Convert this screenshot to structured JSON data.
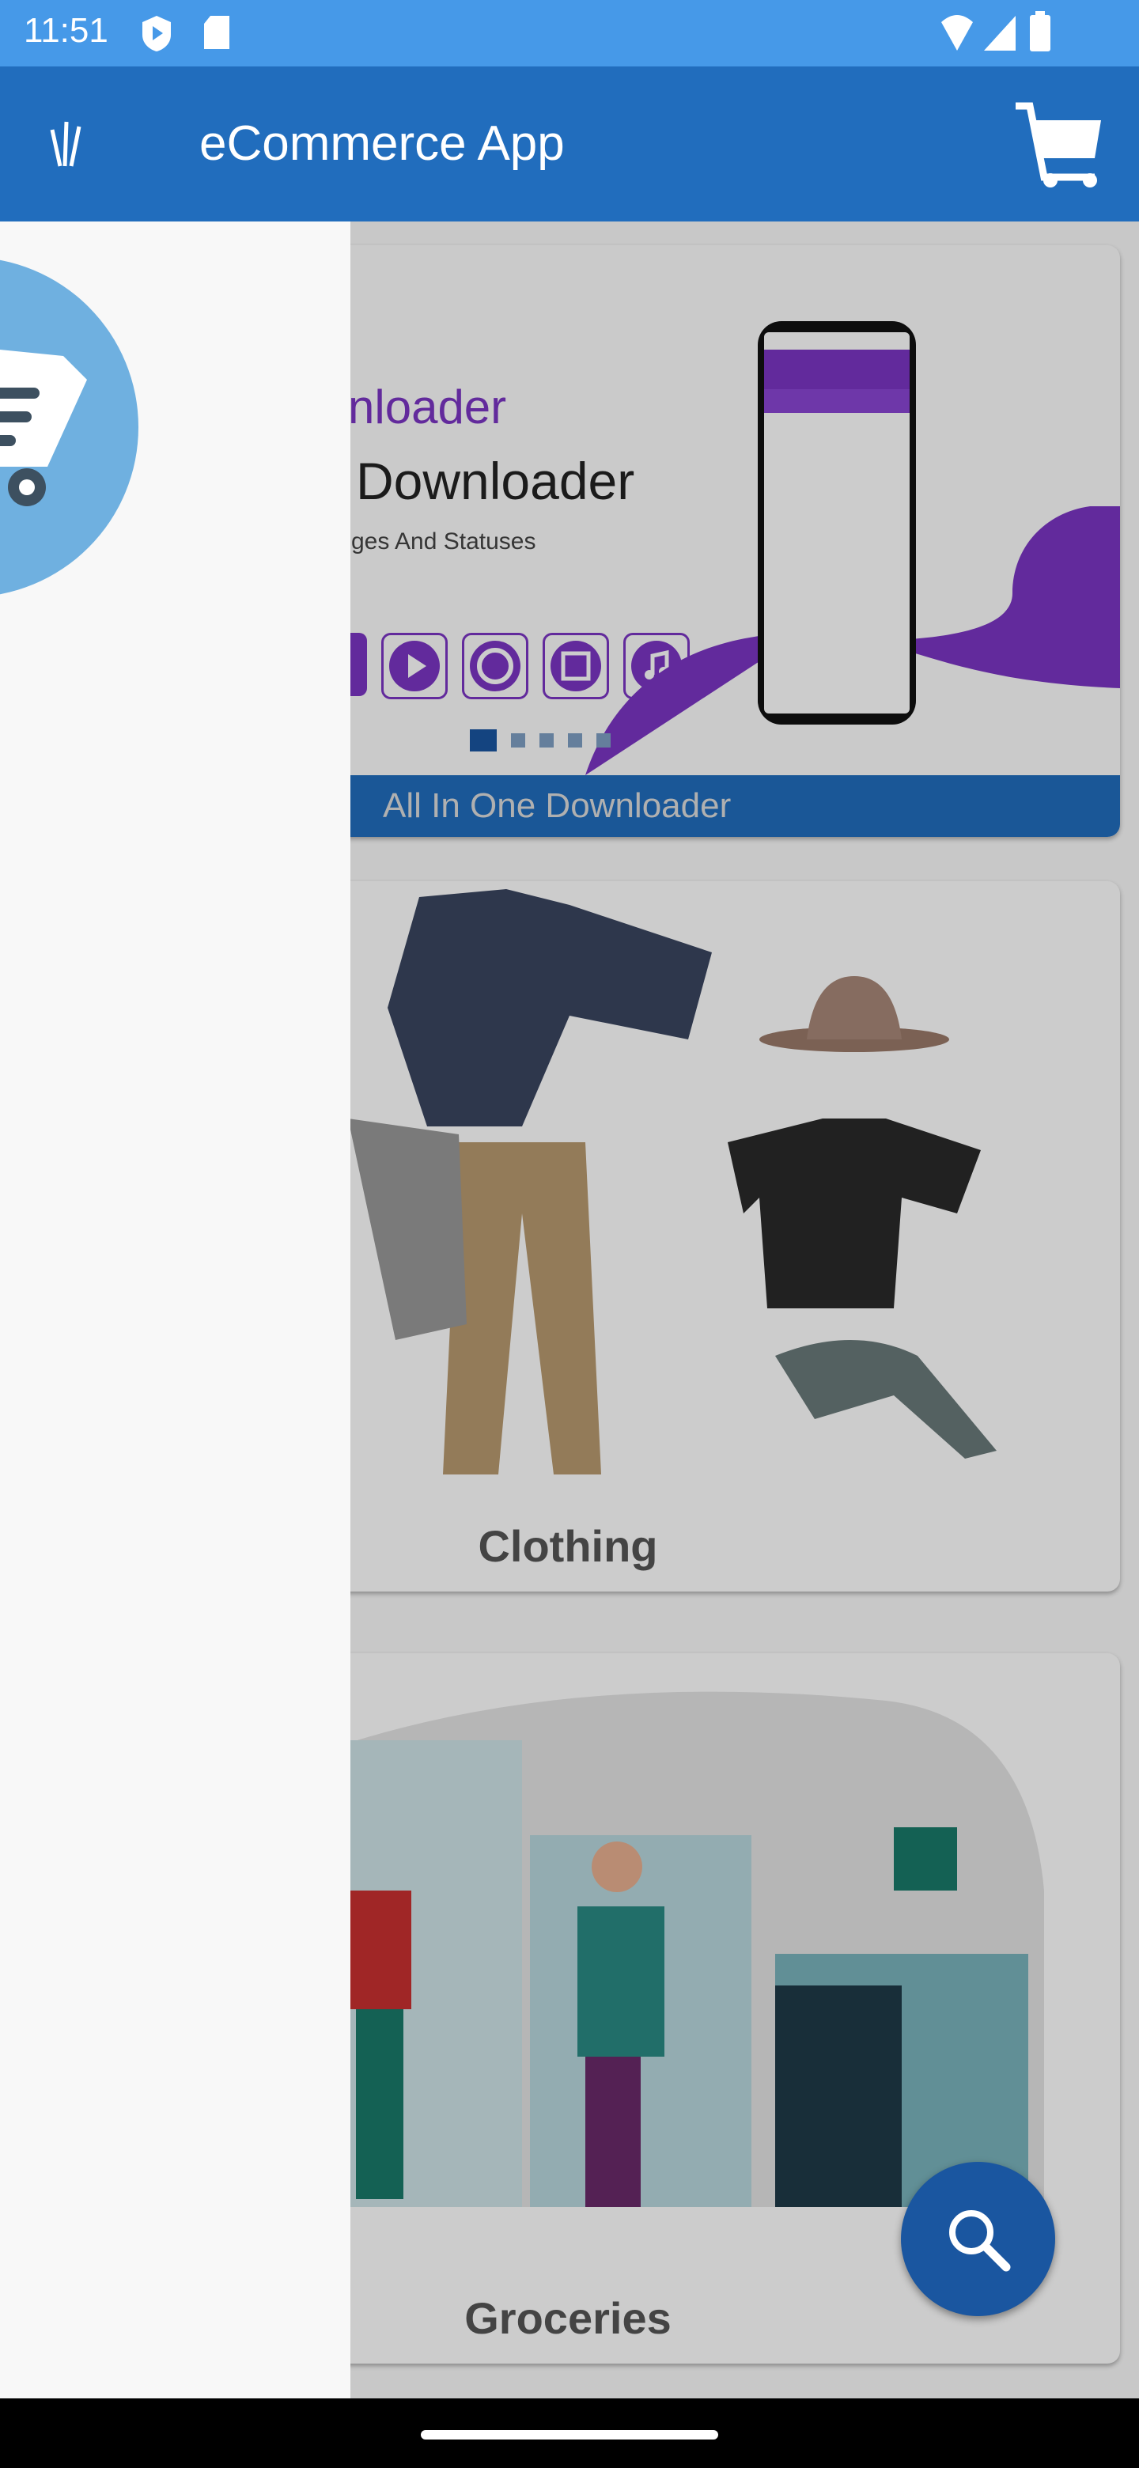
{
  "status_bar": {
    "time": "11:51"
  },
  "app_bar": {
    "title": "eCommerce App"
  },
  "banner": {
    "heading_partial": "nloader",
    "title_partial": "Downloader",
    "subtitle_partial": "ges And Statuses",
    "caption": "All In One Downloader",
    "page_count": 5,
    "current_page": 1
  },
  "categories": [
    {
      "label": "Clothing"
    },
    {
      "label": "Groceries"
    }
  ],
  "colors": {
    "status_bar": "#4699e8",
    "app_bar": "#216dbd",
    "accent_purple": "#7b35c4",
    "fab": "#1a56a0"
  }
}
